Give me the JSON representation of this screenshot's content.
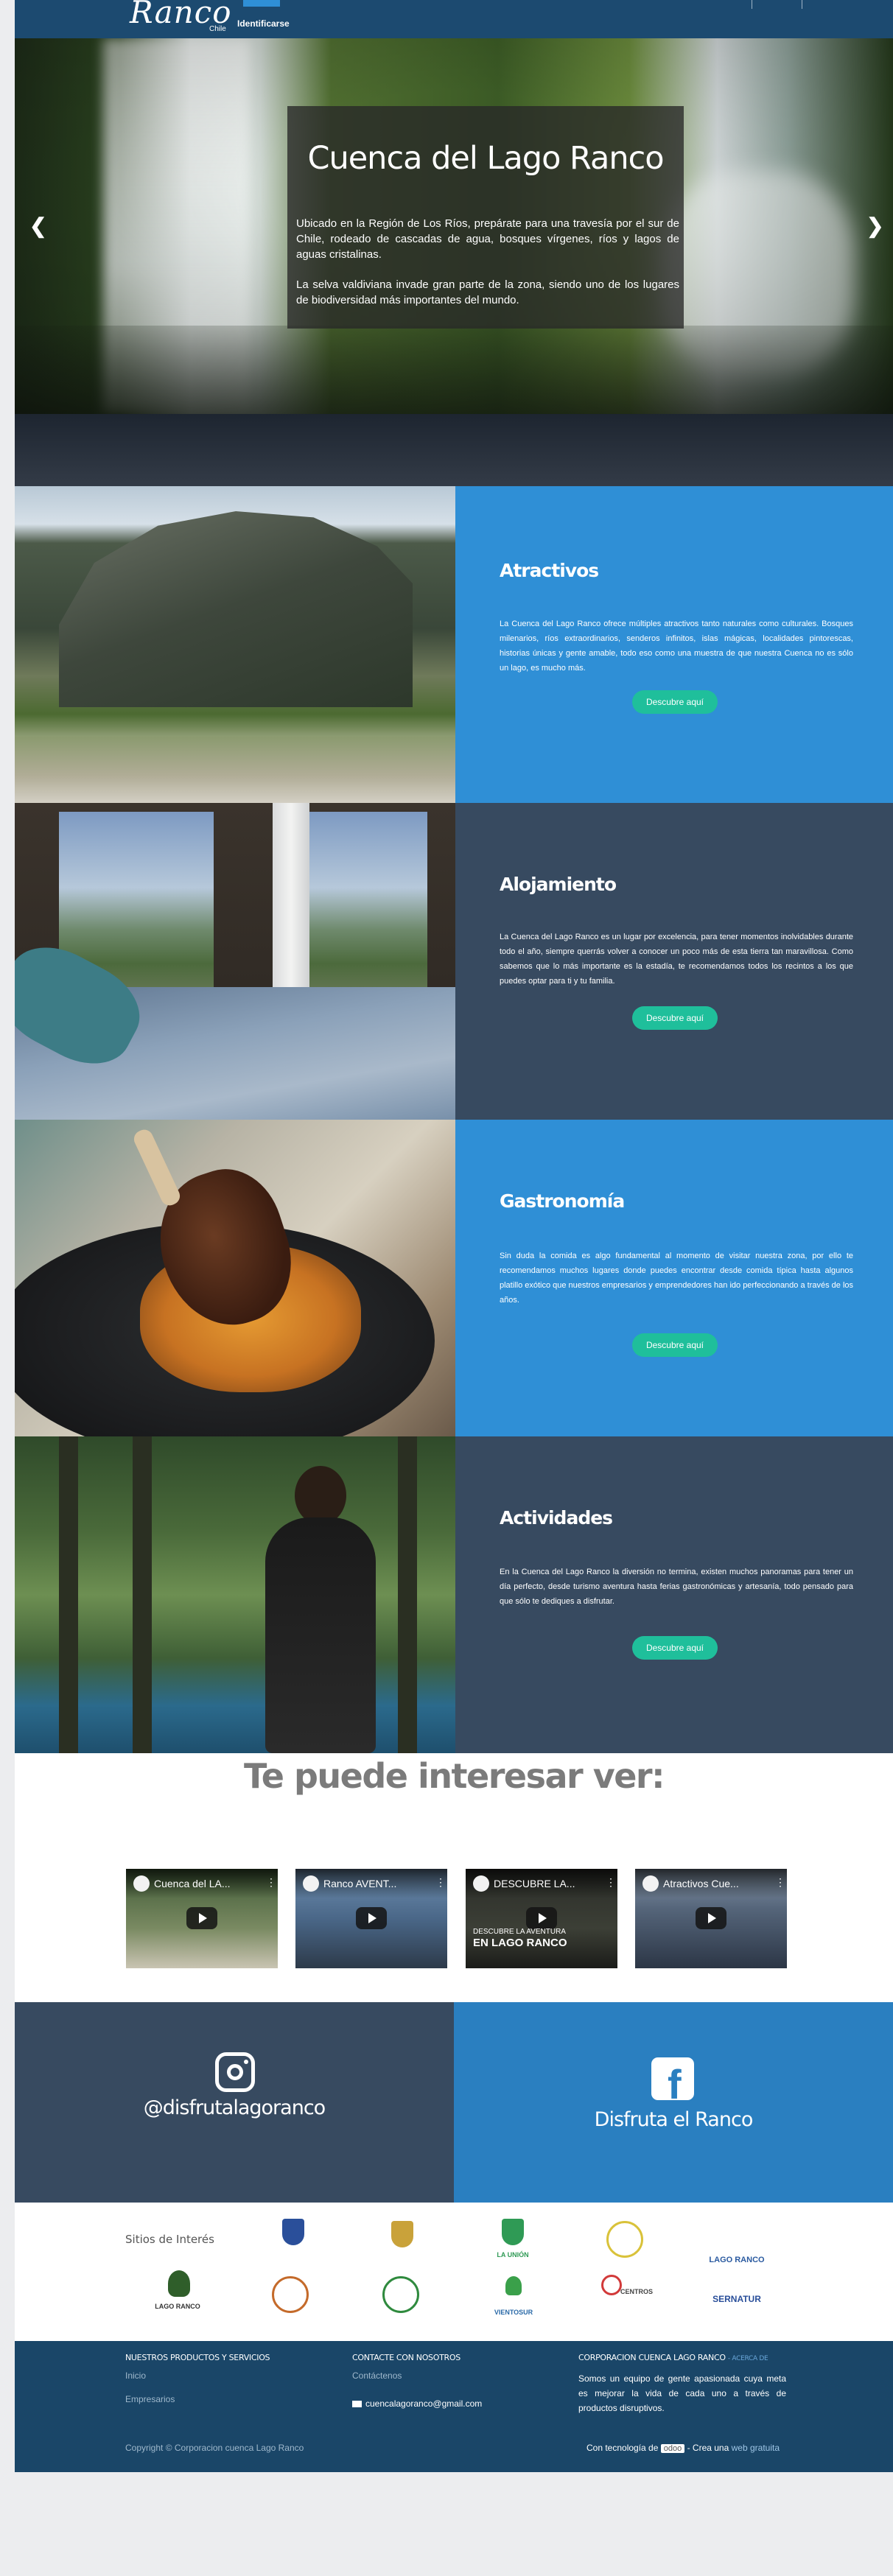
{
  "header": {
    "logo_text": "Ranco",
    "logo_sub": "Chile",
    "login_label": "Identificarse"
  },
  "hero": {
    "title": "Cuenca del Lago Ranco",
    "paragraph_1": "Ubicado en la Región de Los Ríos, prepárate para una travesía por el sur de Chile, rodeado de cascadas de agua, bosques vírgenes, ríos y lagos de aguas cristalinas.",
    "paragraph_2": "La selva valdiviana invade gran parte de la zona, siendo uno de los lugares de biodiversidad más importantes del mundo.",
    "prev_arrow": "❮",
    "next_arrow": "❯"
  },
  "features": [
    {
      "title": "Atractivos",
      "description": "La Cuenca del Lago Ranco ofrece múltiples atractivos tanto naturales como culturales. Bosques milenarios, ríos extraordinarios, senderos infinitos, islas mágicas, localidades pintorescas, historias únicas y gente amable, todo eso como una muestra de que nuestra Cuenca no es sólo un lago, es mucho más.",
      "button": "Descubre aquí"
    },
    {
      "title": "Alojamiento",
      "description": "La Cuenca del Lago Ranco es un lugar por excelencia, para tener momentos inolvidables durante todo el año, siempre querrás volver a conocer un poco más de esta tierra tan maravillosa. Como sabemos que lo más importante es la estadía, te recomendamos todos los recintos a los que puedes optar para ti y tu familia.",
      "button": "Descubre aquí"
    },
    {
      "title": "Gastronomía",
      "description": "Sin duda la comida es algo fundamental al momento de visitar nuestra zona, por ello te recomendamos muchos lugares donde puedes encontrar desde comida típica hasta algunos platillo exótico que nuestros empresarios y emprendedores han ido perfeccionando a través de los años.",
      "button": "Descubre aquí"
    },
    {
      "title": "Actividades",
      "description": "En la Cuenca del Lago Ranco la diversión no termina, existen muchos panoramas para tener un día perfecto, desde turismo aventura hasta ferias gastronómicas y artesanía, todo pensado para que sólo te dediques a disfrutar.",
      "button": "Descubre aquí"
    }
  ],
  "videos": {
    "section_title": "Te puede interesar ver:",
    "items": [
      {
        "title": "Cuenca del LA..."
      },
      {
        "title": "Ranco AVENT..."
      },
      {
        "title": "DESCUBRE LA...",
        "caption_1": "DESCUBRE LA AVENTURA",
        "caption_2": "EN LAGO RANCO"
      },
      {
        "title": "Atractivos Cue..."
      }
    ]
  },
  "social": {
    "instagram": "@disfrutalagoranco",
    "facebook": "Disfruta el Ranco",
    "facebook_glyph": "f"
  },
  "partners": {
    "label": "Sitios de Interés",
    "logos": [
      {
        "text": ""
      },
      {
        "text": ""
      },
      {
        "text": "LA UNIÓN"
      },
      {
        "text": ""
      },
      {
        "text": "LAGO RANCO"
      },
      {
        "text": "LAGO RANCO"
      },
      {
        "text": ""
      },
      {
        "text": ""
      },
      {
        "text": "VIENTOSUR"
      },
      {
        "text": "CENTROS"
      },
      {
        "text": "SERNATUR"
      }
    ]
  },
  "footer": {
    "col1_title": "NUESTROS PRODUCTOS Y SERVICIOS",
    "col1_links": [
      "Inicio",
      "Empresarios"
    ],
    "col2_title": "CONTACTE CON NOSOTROS",
    "col2_link": "Contáctenos",
    "email": "cuencalagoranco@gmail.com",
    "col3_title": "CORPORACION CUENCA LAGO RANCO",
    "col3_suffix": "- ACERCA DE",
    "about": "Somos un equipo de gente apasionada cuya meta es mejorar la vida de cada uno a través de productos disruptivos.",
    "copyright": "Copyright © Corporacion cuenca Lago Ranco",
    "powered_prefix": "Con tecnología de",
    "powered_brand": "odoo",
    "powered_mid": "- Crea una",
    "powered_link": "web gratuita"
  },
  "colors": {
    "header": "#1c4a70",
    "accent_blue": "#2f8fd6",
    "slate": "#374a60",
    "button_green": "#1fbf9b",
    "footer": "#1a4668"
  }
}
